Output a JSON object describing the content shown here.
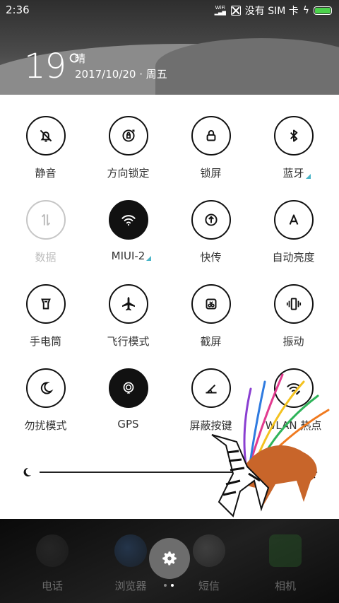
{
  "status_bar": {
    "time": "2:36",
    "wifi_label": "WiFi",
    "carrier": "没有 SIM 卡",
    "battery_color": "#4cd24c"
  },
  "weather": {
    "temperature": "19°",
    "condition": "晴",
    "date": "2017/10/20 · 周五"
  },
  "quick_settings": {
    "tiles": [
      {
        "label": "静音",
        "icon": "bell-off-icon",
        "state": "off"
      },
      {
        "label": "方向锁定",
        "icon": "rotation-lock-icon",
        "state": "off"
      },
      {
        "label": "锁屏",
        "icon": "lock-icon",
        "state": "off"
      },
      {
        "label": "蓝牙",
        "icon": "bluetooth-icon",
        "state": "off",
        "has_more": true
      },
      {
        "label": "数据",
        "icon": "mobile-data-icon",
        "state": "disabled"
      },
      {
        "label": "MIUI-2",
        "icon": "wifi-icon",
        "state": "on",
        "has_more": true
      },
      {
        "label": "快传",
        "icon": "quick-transfer-icon",
        "state": "off"
      },
      {
        "label": "自动亮度",
        "icon": "auto-brightness-icon",
        "state": "off"
      },
      {
        "label": "手电筒",
        "icon": "flashlight-icon",
        "state": "off"
      },
      {
        "label": "飞行模式",
        "icon": "airplane-icon",
        "state": "off"
      },
      {
        "label": "截屏",
        "icon": "screenshot-icon",
        "state": "off"
      },
      {
        "label": "振动",
        "icon": "vibrate-icon",
        "state": "off"
      },
      {
        "label": "勿扰模式",
        "icon": "moon-icon",
        "state": "off"
      },
      {
        "label": "GPS",
        "icon": "gps-icon",
        "state": "on"
      },
      {
        "label": "屏蔽按键",
        "icon": "block-keys-icon",
        "state": "off"
      },
      {
        "label": "WLAN 热点",
        "icon": "hotspot-icon",
        "state": "off"
      }
    ]
  },
  "brightness": {
    "level": 0.0
  },
  "dock": {
    "apps": [
      {
        "label": "电话",
        "icon": "phone-icon"
      },
      {
        "label": "浏览器",
        "icon": "browser-icon"
      },
      {
        "label": "短信",
        "icon": "messages-icon"
      },
      {
        "label": "相机",
        "icon": "camera-icon"
      }
    ],
    "page_indicator": {
      "pages": 2,
      "current": 2
    }
  },
  "colors": {
    "accent": "#4bb5c8",
    "panel_bg": "#ffffff",
    "active_tile": "#111111"
  }
}
